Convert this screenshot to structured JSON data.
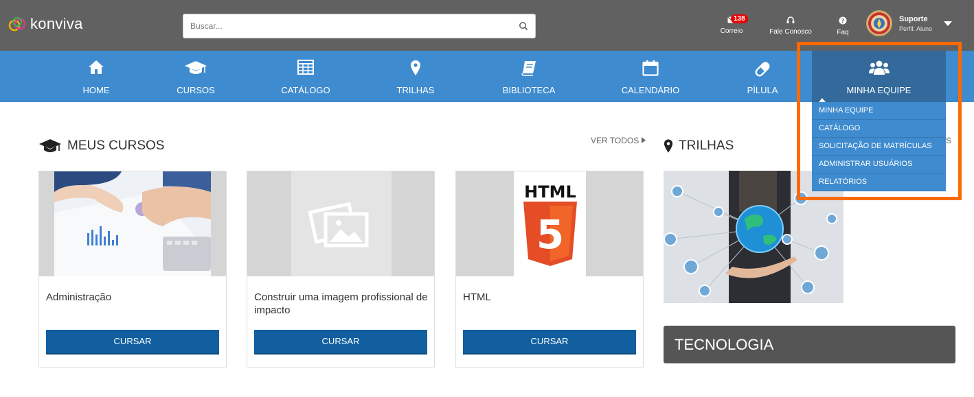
{
  "header": {
    "logo_text": "konviva",
    "search_placeholder": "Buscar...",
    "correio": {
      "label": "Correio",
      "badge": "138"
    },
    "fale_conosco": {
      "label": "Fale Conosco"
    },
    "faq": {
      "label": "Faq"
    },
    "user": {
      "name": "Suporte",
      "role": "Perfil: Aluno"
    }
  },
  "nav": {
    "items": [
      {
        "label": "HOME",
        "icon": "home-icon"
      },
      {
        "label": "CURSOS",
        "icon": "graduation-cap-icon"
      },
      {
        "label": "CATÁLOGO",
        "icon": "grid-table-icon"
      },
      {
        "label": "TRILHAS",
        "icon": "map-marker-icon"
      },
      {
        "label": "BIBLIOTECA",
        "icon": "book-icon"
      },
      {
        "label": "CALENDÁRIO",
        "icon": "calendar-icon"
      },
      {
        "label": "PÍLULA",
        "icon": "pill-icon"
      },
      {
        "label": "MINHA EQUIPE",
        "icon": "team-users-icon"
      }
    ],
    "dropdown": [
      "MINHA EQUIPE",
      "CATÁLOGO",
      "SOLICITAÇÃO DE MATRÍCULAS",
      "ADMINISTRAR USUÁRIOS",
      "RELATÓRIOS"
    ]
  },
  "meus_cursos": {
    "title": "MEUS CURSOS",
    "ver_todos": "VER TODOS",
    "cards": [
      {
        "title": "Administração",
        "button": "CURSAR"
      },
      {
        "title": "Construir uma imagem profissional de impacto",
        "button": "CURSAR"
      },
      {
        "title": "HTML",
        "button": "CURSAR",
        "thumb_text": "HTML",
        "thumb_number": "5"
      }
    ]
  },
  "trilhas": {
    "title": "TRILHAS",
    "ver_todos_partial": "S",
    "category": "TECNOLOGIA"
  },
  "colors": {
    "topbar": "#616161",
    "navbar": "#3f8bcf",
    "nav_active": "#33699b",
    "button": "#115f9f",
    "highlight": "#ff6a00",
    "html5_orange": "#e44d26"
  }
}
